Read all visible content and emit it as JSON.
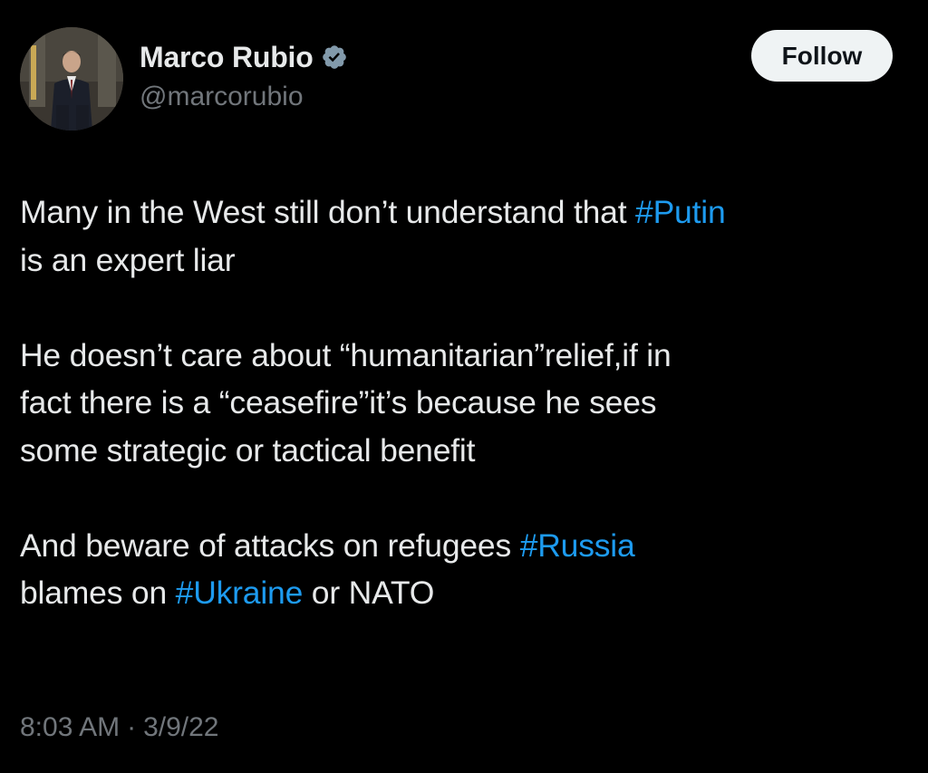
{
  "author": {
    "display_name": "Marco Rubio",
    "handle": "@marcorubio",
    "verified_icon": "verified-badge-icon",
    "avatar_icon": "profile-photo"
  },
  "follow_label": "Follow",
  "tweet": {
    "p1": {
      "l1_text": "Many in the West still don’t understand that ",
      "l1_tag": "#Putin",
      "l2_text": "is an expert liar"
    },
    "p2": {
      "l1": "He doesn’t care about “humanitarian”relief,if in",
      "l2": "fact there is a “ceasefire”it’s because he sees",
      "l3": "some strategic or tactical benefit"
    },
    "p3": {
      "l1_text": "And beware of attacks on refugees ",
      "l1_tag": "#Russia",
      "l2_text_a": "blames on ",
      "l2_tag": "#Ukraine",
      "l2_text_b": " or NATO"
    }
  },
  "meta": {
    "time": "8:03 AM",
    "separator": "·",
    "date": "3/9/22"
  },
  "colors": {
    "background": "#000000",
    "text": "#e7e9ea",
    "secondary": "#71767b",
    "link": "#1d9bf0",
    "button_bg": "#eff3f4"
  }
}
